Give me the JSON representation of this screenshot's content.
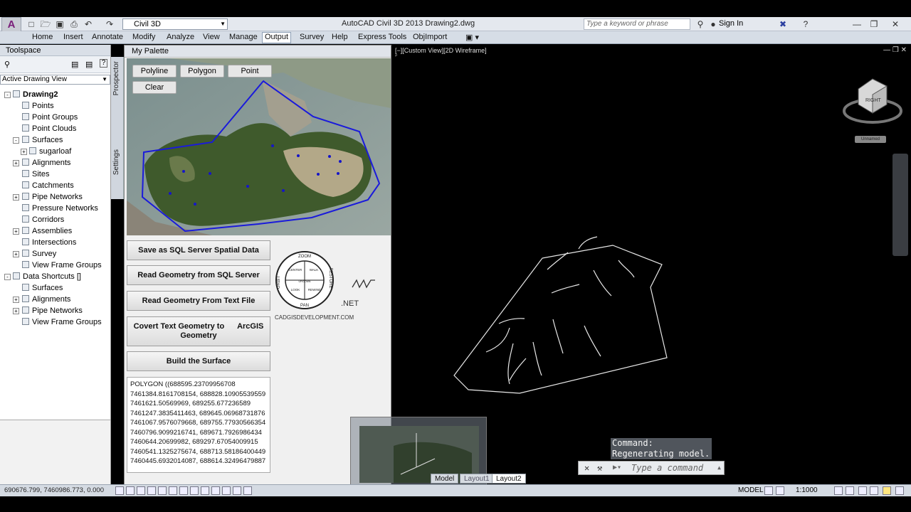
{
  "app": {
    "workspace": "Civil 3D",
    "title": "AutoCAD Civil 3D 2013    Drawing2.dwg",
    "search_placeholder": "Type a keyword or phrase",
    "sign_in": "Sign In"
  },
  "ribbon": {
    "tabs": [
      "Home",
      "Insert",
      "Annotate",
      "Modify",
      "Analyze",
      "View",
      "Manage",
      "Output",
      "Survey",
      "Help",
      "Express Tools",
      "ObjImport"
    ],
    "active_tab": "Output"
  },
  "toolspace": {
    "title": "Toolspace",
    "view_select": "Active Drawing View",
    "side_tabs": [
      "Prospector",
      "Settings"
    ],
    "tree": [
      {
        "label": "Drawing2",
        "level": 0,
        "bold": true,
        "expander": "-"
      },
      {
        "label": "Points",
        "level": 1
      },
      {
        "label": "Point Groups",
        "level": 1
      },
      {
        "label": "Point Clouds",
        "level": 1
      },
      {
        "label": "Surfaces",
        "level": 1,
        "expander": "-"
      },
      {
        "label": "sugarloaf",
        "level": 2,
        "expander": "+"
      },
      {
        "label": "Alignments",
        "level": 1,
        "expander": "+"
      },
      {
        "label": "Sites",
        "level": 1
      },
      {
        "label": "Catchments",
        "level": 1
      },
      {
        "label": "Pipe Networks",
        "level": 1,
        "expander": "+"
      },
      {
        "label": "Pressure Networks",
        "level": 1
      },
      {
        "label": "Corridors",
        "level": 1
      },
      {
        "label": "Assemblies",
        "level": 1,
        "expander": "+"
      },
      {
        "label": "Intersections",
        "level": 1
      },
      {
        "label": "Survey",
        "level": 1,
        "expander": "+"
      },
      {
        "label": "View Frame Groups",
        "level": 1
      },
      {
        "label": "Data Shortcuts []",
        "level": 0,
        "expander": "-"
      },
      {
        "label": "Surfaces",
        "level": 1
      },
      {
        "label": "Alignments",
        "level": 1,
        "expander": "+"
      },
      {
        "label": "Pipe Networks",
        "level": 1,
        "expander": "+"
      },
      {
        "label": "View Frame Groups",
        "level": 1
      }
    ]
  },
  "palette": {
    "title": "My Palette",
    "draw_buttons": [
      "Polyline",
      "Polygon",
      "Point"
    ],
    "clear_button": "Clear",
    "actions": [
      "Save as SQL Server Spatial Data",
      "Read Geometry from SQL Server",
      "Read Geometry From Text File",
      "Covert Text Geometry to      ArcGIS Geometry",
      "Build the Surface"
    ],
    "logo_caption": "CADGISDEVELOPMENT.COM",
    "dotnet_label": ".NET",
    "wkt_lines": [
      "POLYGON ((688595.23709956708",
      "7461384.8161708154, 688828.10905539559",
      "7461621.50569969, 689255.677236589",
      "7461247.3835411463, 689645.06968731876",
      "7461067.9576079668, 689755.77930566354",
      "7460796.9099216741, 689671.7926986434",
      "7460644.20699982, 689297.67054009915",
      "7460541.1325275674, 688713.58186400449",
      "7460445.6932014087, 688614.32496479887"
    ],
    "logo_words": [
      "ZOOM",
      "ORBIT",
      "PAN",
      "RESTORE",
      "REWIND",
      "CENTER",
      "WALK",
      "LOOK",
      "UP/DOWN"
    ]
  },
  "viewport": {
    "label": "[−][Custom View][2D Wireframe]",
    "viewcube_face": "RIGHT",
    "viewcube_tag": "Unnamed"
  },
  "command": {
    "history": [
      "Command:",
      "Regenerating model."
    ],
    "placeholder": "Type a command"
  },
  "layout_tabs": [
    "Model",
    "Layout1",
    "Layout2"
  ],
  "status": {
    "coords": "690676.799, 7460986.773, 0.000",
    "model": "MODEL",
    "scale": "1:1000"
  },
  "colors": {
    "boundary": "#1a1adb",
    "accent_active_tab": "#ffffff",
    "viewport_bg": "#000000"
  }
}
